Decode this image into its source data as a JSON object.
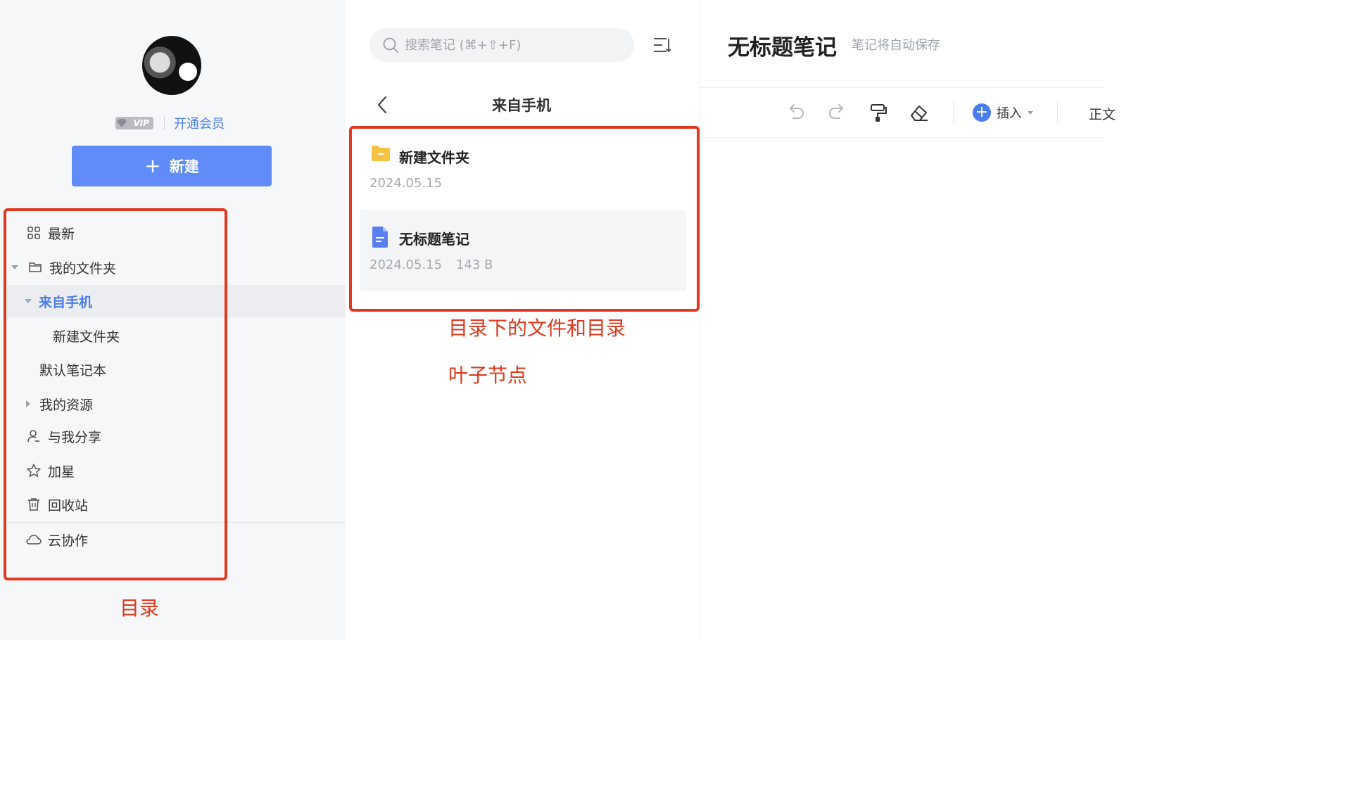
{
  "sidebar": {
    "vip_badge": "VIP",
    "vip_link": "开通会员",
    "new_button": "新建",
    "items": [
      {
        "label": "最新",
        "icon": "grid-icon"
      },
      {
        "label": "我的文件夹",
        "icon": "folder-outline-icon"
      },
      {
        "label": "来自手机",
        "icon": "caret-down-icon"
      },
      {
        "label": "新建文件夹"
      },
      {
        "label": "默认笔记本"
      },
      {
        "label": "我的资源",
        "icon": "caret-right-icon"
      },
      {
        "label": "与我分享",
        "icon": "person-icon"
      },
      {
        "label": "加星",
        "icon": "star-icon"
      },
      {
        "label": "回收站",
        "icon": "trash-icon"
      },
      {
        "label": "云协作",
        "icon": "cloud-icon"
      }
    ]
  },
  "middle": {
    "search_placeholder": "搜索笔记 (⌘+⇧+F)",
    "folder_title": "来自手机",
    "files": [
      {
        "name": "新建文件夹",
        "date": "2024.05.15",
        "type": "folder"
      },
      {
        "name": "无标题笔记",
        "date": "2024.05.15",
        "size": "143 B",
        "type": "note"
      }
    ]
  },
  "editor": {
    "title": "无标题笔记",
    "autosave": "笔记将自动保存",
    "insert_label": "插入",
    "text_style": "正文"
  },
  "annotations": {
    "nav": "目录",
    "files": "目录下的文件和目录",
    "leaf": "叶子节点"
  },
  "colors": {
    "accent": "#5f8cf7",
    "annotation": "#e0391f",
    "folder": "#f6c244",
    "note": "#5b7ff0"
  }
}
